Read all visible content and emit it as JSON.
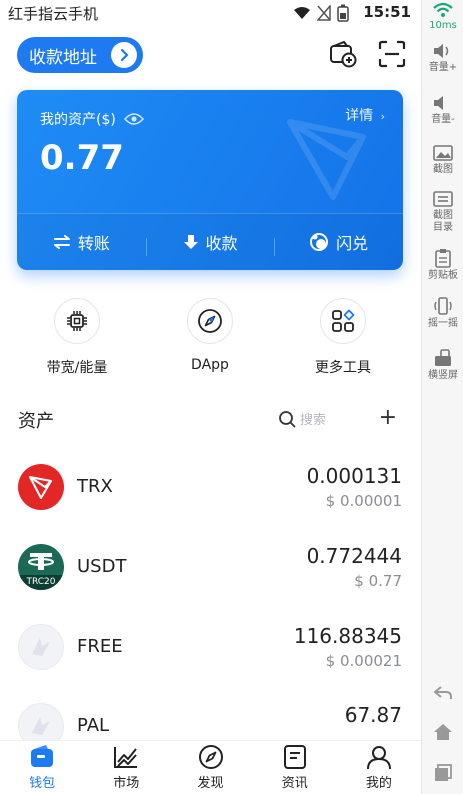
{
  "status_bar": {
    "carrier": "红手指云手机",
    "time": "15:51"
  },
  "header": {
    "address_button_label": "收款地址"
  },
  "asset_card": {
    "label": "我的资产($)",
    "detail_label": "详情",
    "amount": "0.77",
    "actions": [
      {
        "label": "转账",
        "icon": "transfer-icon"
      },
      {
        "label": "收款",
        "icon": "receive-icon"
      },
      {
        "label": "闪兑",
        "icon": "swap-icon"
      }
    ]
  },
  "tools": [
    {
      "label": "带宽/能量",
      "icon": "chip-icon"
    },
    {
      "label": "DApp",
      "icon": "compass-icon"
    },
    {
      "label": "更多工具",
      "icon": "grid-icon"
    }
  ],
  "assets": {
    "title": "资产",
    "search_placeholder": "搜索"
  },
  "tokens": [
    {
      "symbol": "TRX",
      "balance": "0.000131",
      "value": "$ 0.00001",
      "color": "#e32726"
    },
    {
      "symbol": "USDT",
      "balance": "0.772444",
      "value": "$ 0.77",
      "color": "#1a6a55",
      "badge": "TRC20"
    },
    {
      "symbol": "FREE",
      "balance": "116.88345",
      "value": "$ 0.00021",
      "color": "#f1f3f7"
    },
    {
      "symbol": "PAL",
      "balance": "67.87",
      "value": "",
      "color": "#f1f3f7"
    }
  ],
  "nav": [
    {
      "label": "钱包",
      "icon": "wallet-icon",
      "active": true
    },
    {
      "label": "市场",
      "icon": "chart-icon",
      "active": false
    },
    {
      "label": "发现",
      "icon": "compass-icon",
      "active": false
    },
    {
      "label": "资讯",
      "icon": "news-icon",
      "active": false
    },
    {
      "label": "我的",
      "icon": "profile-icon",
      "active": false
    }
  ],
  "side_toolbar": {
    "signal_text": "10ms",
    "items": [
      {
        "label": "音量+",
        "icon": "volume-up-icon"
      },
      {
        "label": "音量-",
        "icon": "volume-down-icon"
      },
      {
        "label": "截图",
        "icon": "screenshot-icon"
      },
      {
        "label": "截图目录",
        "icon": "screenshot-folder-icon"
      },
      {
        "label": "剪贴板",
        "icon": "clipboard-icon"
      },
      {
        "label": "摇一摇",
        "icon": "shake-icon"
      },
      {
        "label": "横竖屏",
        "icon": "rotate-icon"
      }
    ]
  },
  "colors": {
    "primary": "#1d7af1",
    "trx_red": "#e32726",
    "usdt_green": "#1a6a55"
  }
}
